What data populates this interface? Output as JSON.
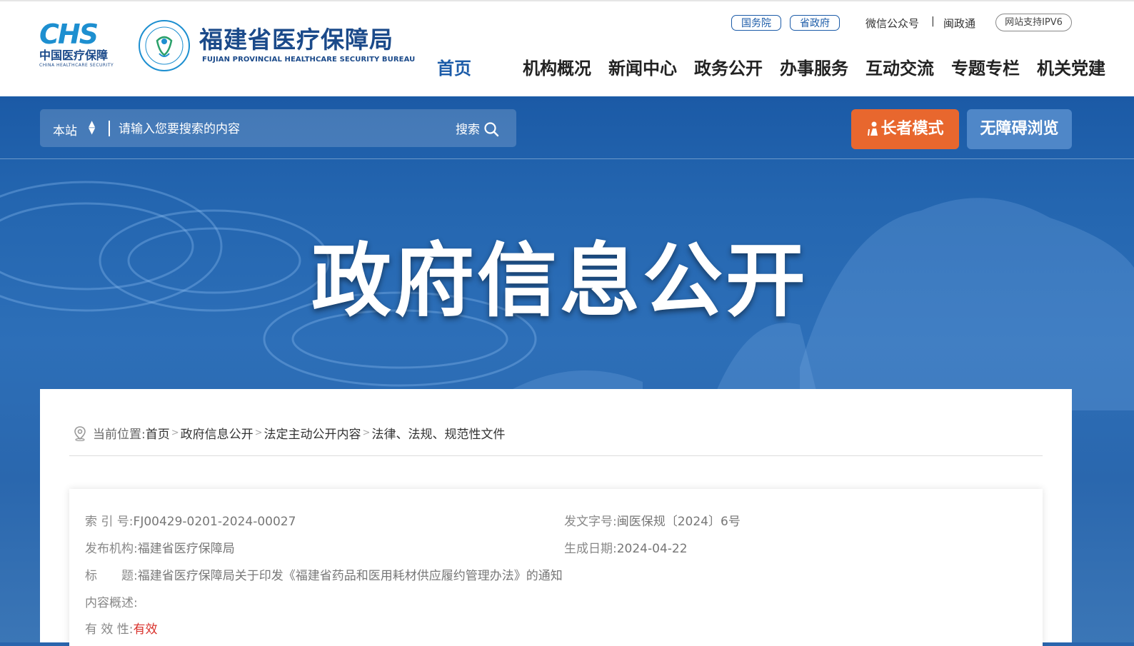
{
  "header": {
    "chs_mark": "CHS",
    "chs_cn": "中国医疗保障",
    "chs_en": "CHINA HEALTHCARE SECURITY",
    "bureau_cn": "福建省医疗保障局",
    "bureau_en": "FUJIAN PROVINCIAL HEALTHCARE SECURITY BUREAU",
    "pill_state_council": "国务院",
    "pill_province": "省政府",
    "wechat": "微信公众号",
    "sep": "|",
    "minzhengtong": "闽政通",
    "ipv6": "网站支持IPV6",
    "nav": [
      "首页",
      "机构概况",
      "新闻中心",
      "政务公开",
      "办事服务",
      "互动交流",
      "专题专栏",
      "机关党建"
    ],
    "active_nav": "首页"
  },
  "search": {
    "scope": "本站",
    "placeholder": "请输入您要搜索的内容",
    "button": "搜索"
  },
  "modes": {
    "elder": "长者模式",
    "accessible": "无障碍浏览"
  },
  "hero_title": "政府信息公开",
  "breadcrumb": {
    "label": "当前位置:",
    "items": [
      "首页",
      "政府信息公开",
      "法定主动公开内容",
      "法律、法规、规范性文件"
    ]
  },
  "info": {
    "index_label": "索 引 号:",
    "index_value": "FJ00429-0201-2024-00027",
    "docno_label": "发文字号:",
    "docno_value": "闽医保规〔2024〕6号",
    "publisher_label": "发布机构:",
    "publisher_value": "福建省医疗保障局",
    "date_label": "生成日期:",
    "date_value": "2024-04-22",
    "title_label": "标　　题:",
    "title_value": "福建省医疗保障局关于印发《福建省药品和医用耗材供应履约管理办法》的通知",
    "summary_label": "内容概述:",
    "summary_value": "",
    "validity_label": "有 效 性:",
    "validity_value": "有效"
  },
  "colors": {
    "brand_blue": "#1b5ba8",
    "elder_orange": "#e8672e",
    "valid_red": "#d9302a"
  }
}
